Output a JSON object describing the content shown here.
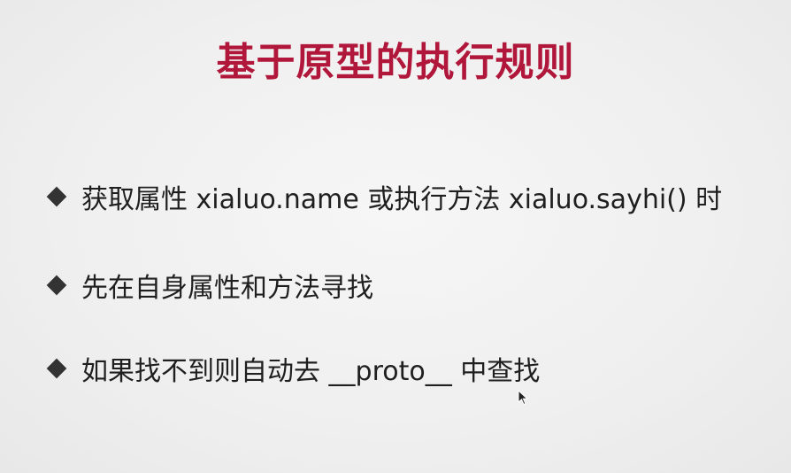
{
  "slide": {
    "title": "基于原型的执行规则",
    "bullets": [
      {
        "text": "获取属性 xialuo.name 或执行方法 xialuo.sayhi()  时"
      },
      {
        "text": "先在自身属性和方法寻找"
      },
      {
        "text": "如果找不到则自动去 __proto__ 中查找"
      }
    ]
  },
  "colors": {
    "title": "#b0173a",
    "text": "#1f1f1f",
    "background": "#f2f2f2"
  },
  "icons": {
    "bullet": "diamond-bullet-icon",
    "cursor": "mouse-pointer-icon"
  }
}
